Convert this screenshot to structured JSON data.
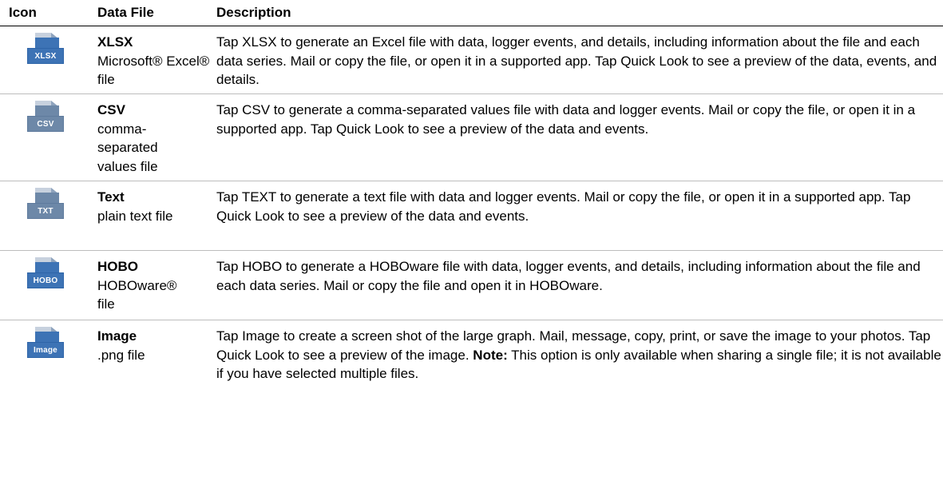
{
  "header": {
    "icon_label": "Icon",
    "file_label": "Data File",
    "desc_label": "Description"
  },
  "rows": [
    {
      "icon": "xlsx-file-icon",
      "icon_text": "XLSX",
      "file_type": "XLSX",
      "file_desc": "Microsoft® Excel® file",
      "description": "Tap XLSX to generate an Excel file with data, logger events, and details, including information about the file and each data series. Mail or copy the file, or open it in a supported app. Tap Quick Look to see a preview of the data, events, and details."
    },
    {
      "icon": "csv-file-icon",
      "icon_text": "CSV",
      "file_type": "CSV",
      "file_desc": "comma-separated values file",
      "description": "Tap CSV to generate a comma-separated values file with data and logger events. Mail or copy the file, or open it in a supported app. Tap Quick Look to see a preview of the data and events."
    },
    {
      "icon": "txt-file-icon",
      "icon_text": "TXT",
      "file_type": "Text",
      "file_desc": "plain text file",
      "description": "Tap TEXT to generate a text file with data and logger events. Mail or copy the file, or open it in a supported app. Tap Quick Look to see a preview of the data and events."
    },
    {
      "icon": "hobo-file-icon",
      "icon_text": "HOBO",
      "file_type": "HOBO",
      "file_desc": "HOBOware® file",
      "description": "Tap HOBO to generate a HOBOware file with data, logger events, and details, including information about the file and each data series. Mail or copy the file and open it in HOBOware."
    },
    {
      "icon": "image-file-icon",
      "icon_text": "Image",
      "file_type": "Image",
      "file_desc": ".png file",
      "description": "Tap Image to create a screen shot of the large graph. Mail, message, copy, print, or save the image to your photos. Tap Quick Look to see a preview of the image.",
      "note_label": "Note:",
      "note_text": "This option is only available when sharing a single file; it is not available if you have selected multiple files."
    }
  ],
  "colors": {
    "icon_body": "#3d73b5",
    "icon_top": "#b9c5d3",
    "row_border": "#bdbdbd",
    "header_border": "#000000"
  }
}
